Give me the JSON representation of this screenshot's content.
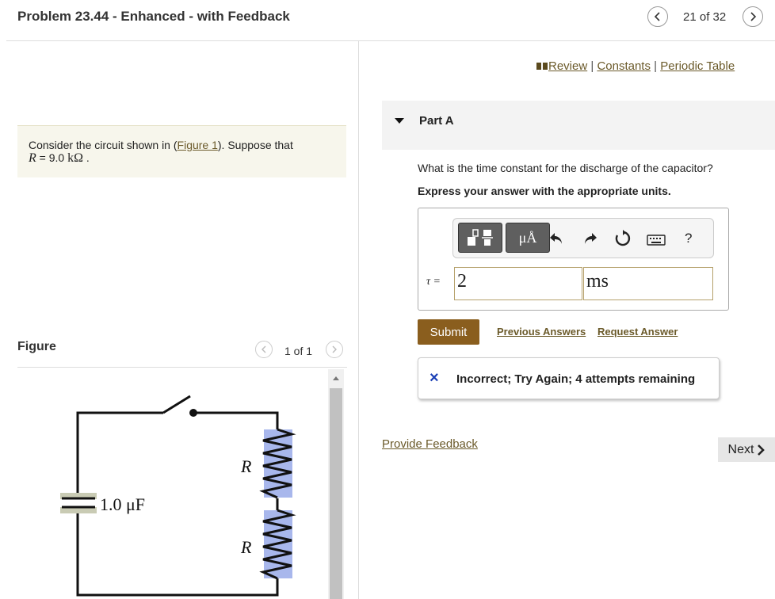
{
  "header": {
    "title": "Problem 23.44 - Enhanced - with Feedback",
    "counter": "21 of 32"
  },
  "links": {
    "review": "Review",
    "constants": "Constants",
    "periodic_table": "Periodic Table",
    "separator": "|"
  },
  "problem": {
    "text_before": "Consider the circuit shown in (",
    "figure_link": "Figure 1",
    "text_after": "). Suppose that",
    "var": "R",
    "equals": " = 9.0 ",
    "unit": "kΩ",
    "period": " ."
  },
  "figure": {
    "label": "Figure",
    "counter": "1 of 1",
    "capacitor_label": "1.0 μF",
    "resistor_top_label": "R",
    "resistor_bottom_label": "R"
  },
  "part": {
    "title": "Part A",
    "question": "What is the time constant for the discharge of the capacitor?",
    "instruction": "Express your answer with the appropriate units."
  },
  "toolbar": {
    "units_button": "μÅ",
    "help_label": "?"
  },
  "answer": {
    "label": "τ =",
    "value": "2",
    "unit": "ms"
  },
  "actions": {
    "submit": "Submit",
    "previous_answers": "Previous Answers",
    "request_answer": "Request Answer"
  },
  "feedback": {
    "icon": "×",
    "message": "Incorrect; Try Again; 4 attempts remaining"
  },
  "footer": {
    "provide_feedback": "Provide Feedback",
    "next": "Next"
  },
  "colors": {
    "submit_bg": "#8a5e1e",
    "link": "#6b5a2a",
    "error_x": "#1a3fb5",
    "resistor_fill": "#a8b7ec"
  }
}
